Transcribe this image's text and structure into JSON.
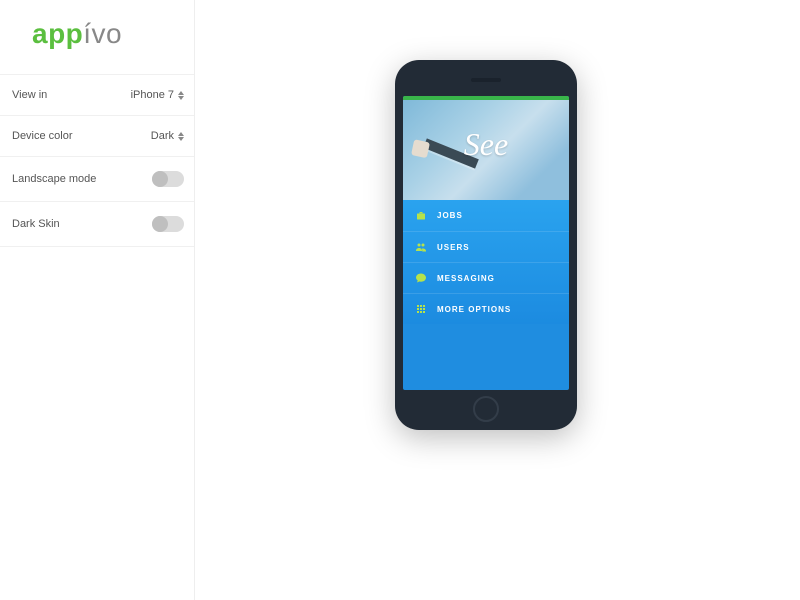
{
  "brand": {
    "part1": "app",
    "part2": "ívo"
  },
  "sidebar": {
    "view_in": {
      "label": "View in",
      "value": "iPhone 7"
    },
    "device_color": {
      "label": "Device color",
      "value": "Dark"
    },
    "landscape": {
      "label": "Landscape mode",
      "on": false
    },
    "dark_skin": {
      "label": "Dark Skin",
      "on": false
    }
  },
  "preview": {
    "hero_title": "See",
    "menu": [
      {
        "icon": "briefcase-icon",
        "label": "JOBS"
      },
      {
        "icon": "users-icon",
        "label": "USERS"
      },
      {
        "icon": "chat-icon",
        "label": "MESSAGING"
      },
      {
        "icon": "grid-icon",
        "label": "MORE OPTIONS"
      }
    ]
  }
}
